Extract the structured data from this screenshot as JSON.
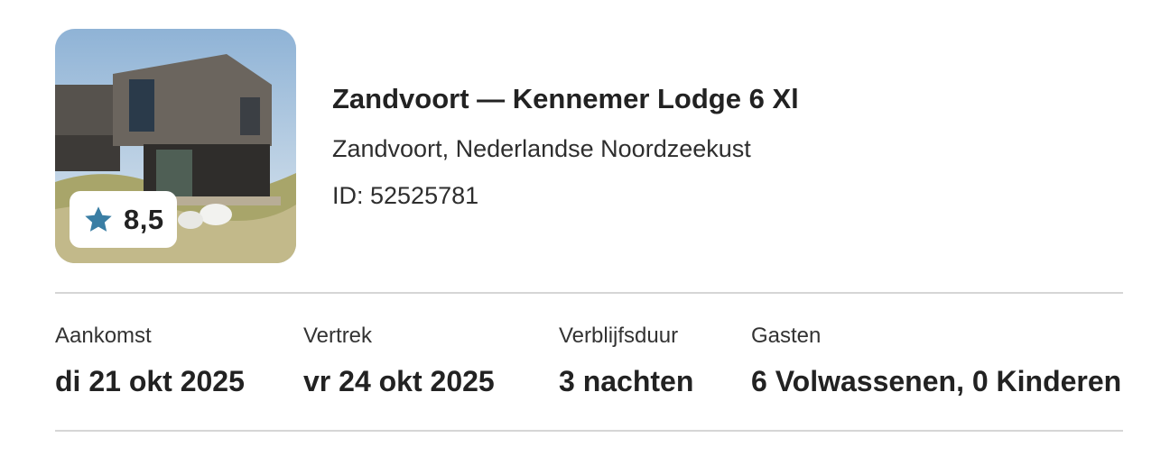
{
  "listing": {
    "title": "Zandvoort — Kennemer Lodge 6 Xl",
    "location": "Zandvoort, Nederlandse Noordzeekust",
    "id_text": "ID: 52525781",
    "rating": "8,5",
    "photo_alt": "Kennemer Lodge 6 Xl",
    "rating_icon": "star-icon",
    "accent_color": "#3a7ea4"
  },
  "stay": {
    "arrival_label": "Aankomst",
    "arrival_value": "di 21 okt 2025",
    "departure_label": "Vertrek",
    "departure_value": "vr 24 okt 2025",
    "duration_label": "Verblijfsduur",
    "duration_value": "3 nachten",
    "guests_label": "Gasten",
    "guests_value": "6 Volwassenen, 0 Kinderen"
  }
}
